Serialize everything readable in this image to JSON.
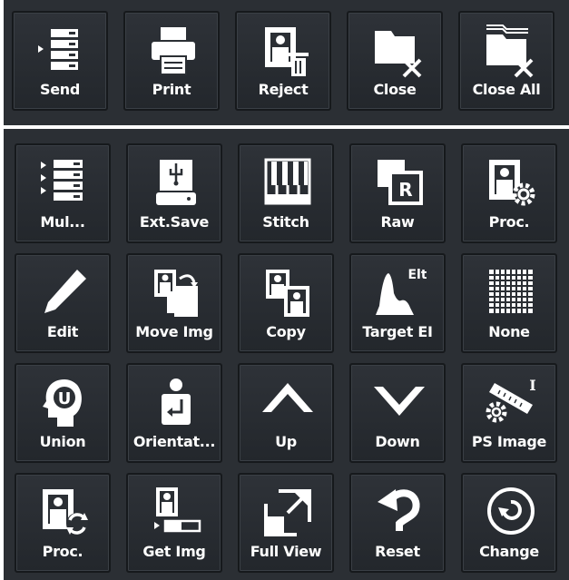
{
  "toolbar": {
    "send": "Send",
    "print": "Print",
    "reject": "Reject",
    "close": "Close",
    "close_all": "Close All"
  },
  "grid": {
    "multi": "Mul...",
    "ext_save": "Ext.Save",
    "stitch": "Stitch",
    "raw": "Raw",
    "proc1": "Proc.",
    "edit": "Edit",
    "move_img": "Move Img",
    "copy": "Copy",
    "target_ei": "Target EI",
    "none": "None",
    "union": "Union",
    "orientation": "Orientat...",
    "up": "Up",
    "down": "Down",
    "ps_image": "PS Image",
    "proc2": "Proc.",
    "get_img": "Get Img",
    "full_view": "Full View",
    "reset": "Reset",
    "change": "Change"
  },
  "icon_text": {
    "raw_letter": "R",
    "elt": "Elt",
    "union_letter": "U",
    "ruler_letter": "I"
  },
  "colors": {
    "panel": "#2b2f34",
    "icon": "#ffffff",
    "label": "#ffffff"
  }
}
